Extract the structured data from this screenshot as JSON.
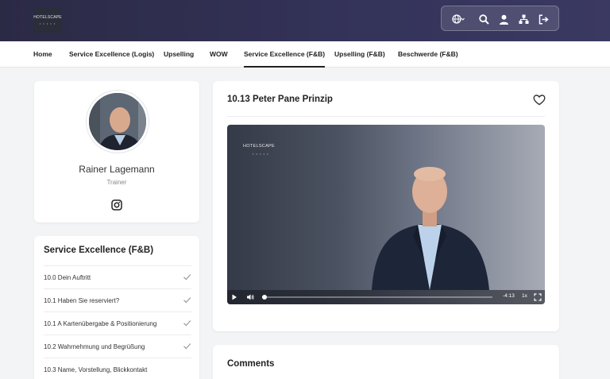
{
  "header": {
    "logo_text": "HOTELSCAPE",
    "logo_dots": "• • • • •",
    "icons": [
      "globe-icon",
      "chevron-down-icon",
      "search-icon",
      "user-icon",
      "sitemap-icon",
      "logout-icon"
    ]
  },
  "nav": {
    "items": [
      {
        "label": "Home"
      },
      {
        "label": "Service Excellence (Logis)"
      },
      {
        "label": "Upselling"
      },
      {
        "label": "WOW"
      },
      {
        "label": "Service Excellence (F&B)"
      },
      {
        "label": "Upselling (F&B)"
      },
      {
        "label": "Beschwerde (F&B)"
      }
    ],
    "active_index": 4
  },
  "trainer": {
    "name": "Rainer Lagemann",
    "role": "Trainer",
    "social_icon": "instagram-icon"
  },
  "course": {
    "title": "Service Excellence (F&B)",
    "lessons": [
      {
        "label": "10.0 Dein Auftritt",
        "completed": true
      },
      {
        "label": "10.1 Haben Sie reserviert?",
        "completed": true
      },
      {
        "label": "10.1 A Kartenübergabe & Positionierung",
        "completed": true
      },
      {
        "label": "10.2 Wahrnehmung und Begrüßung",
        "completed": true
      },
      {
        "label": "10.3 Name, Vorstellung, Blickkontakt",
        "completed": false
      }
    ]
  },
  "video": {
    "title": "10.13 Peter Pane Prinzip",
    "logo_text": "HOTELSCAPE",
    "logo_dots": "• • • • •",
    "time_remaining": "-4:13",
    "speed": "1x",
    "progress": 0.01
  },
  "comments": {
    "title": "Comments"
  },
  "colors": {
    "header_bg": "#2b2a45",
    "page_bg": "#f3f4f6",
    "check": "#9a9aa2"
  }
}
